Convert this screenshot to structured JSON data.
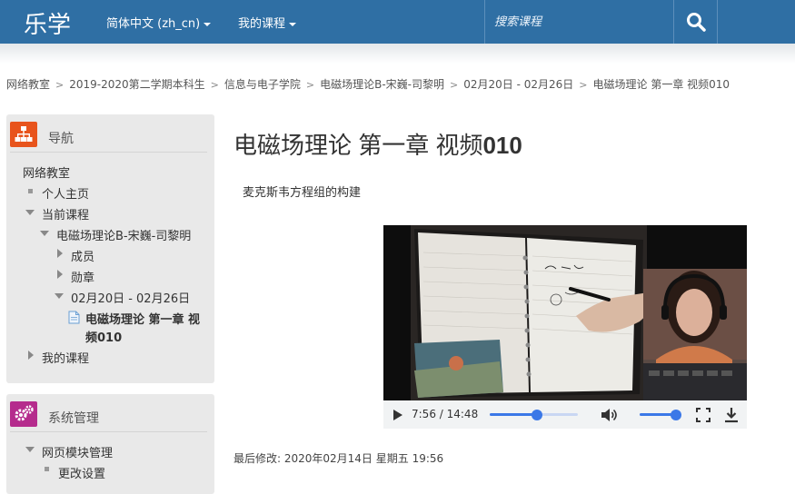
{
  "header": {
    "brand": "乐学",
    "language": "简体中文 (zh_cn)",
    "my_courses": "我的课程",
    "search_placeholder": "搜索课程"
  },
  "breadcrumb": [
    "网络教室",
    "2019-2020第二学期本科生",
    "信息与电子学院",
    "电磁场理论B-宋巍-司黎明",
    "02月20日 - 02月26日",
    "电磁场理论 第一章 视频010"
  ],
  "nav_block": {
    "title": "导航",
    "items": [
      "网络教室",
      "个人主页",
      "当前课程",
      "电磁场理论B-宋巍-司黎明",
      "成员",
      "勋章",
      "02月20日 - 02月26日",
      "电磁场理论 第一章 视",
      "频010",
      "我的课程"
    ]
  },
  "admin_block": {
    "title": "系统管理",
    "items": [
      "网页模块管理",
      "更改设置"
    ]
  },
  "main": {
    "title_prefix": "电磁场理论 第一章 视频",
    "title_number": "010",
    "description": "麦克斯韦方程组的构建",
    "video_time": "7:56 / 14:48",
    "video_progress": 0.536,
    "volume_level": 1.0,
    "last_modified": "最后修改: 2020年02月14日 星期五 19:56"
  },
  "colors": {
    "header_bg": "#2f6fa4",
    "nav_icon": "#e8541c",
    "admin_icon": "#b52c8d",
    "player_accent": "#3b78e7"
  }
}
